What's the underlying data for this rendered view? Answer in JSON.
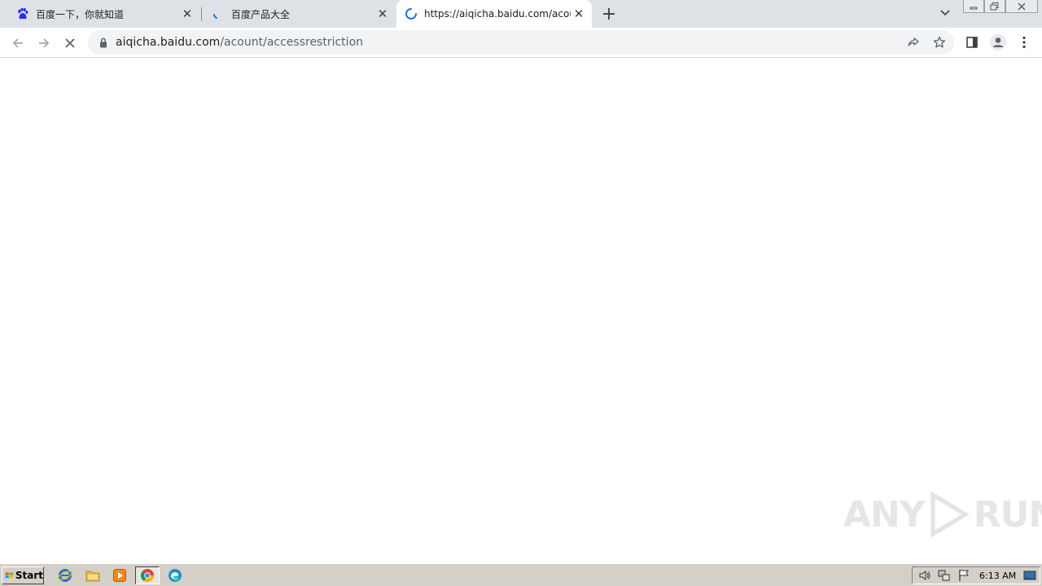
{
  "tabs": [
    {
      "title": "百度一下，你就知道",
      "favicon": "baidu-paw-icon",
      "active": false
    },
    {
      "title": "百度产品大全",
      "favicon": "loading-spinner-icon",
      "active": false
    },
    {
      "title": "https://aiqicha.baidu.com/acount/ac",
      "favicon": "loading-spinner-icon",
      "active": true
    }
  ],
  "address_bar": {
    "host": "aiqicha.baidu.com",
    "path": "/acount/accessrestriction"
  },
  "watermark": {
    "left": "ANY",
    "right": "RUN"
  },
  "taskbar": {
    "start_label": "Start",
    "clock": "6:13 AM"
  },
  "colors": {
    "tabstrip": "#dee1e6",
    "omnibox": "#f1f3f4",
    "accent": "#1a73e8",
    "taskbar": "#d4d0c8"
  }
}
